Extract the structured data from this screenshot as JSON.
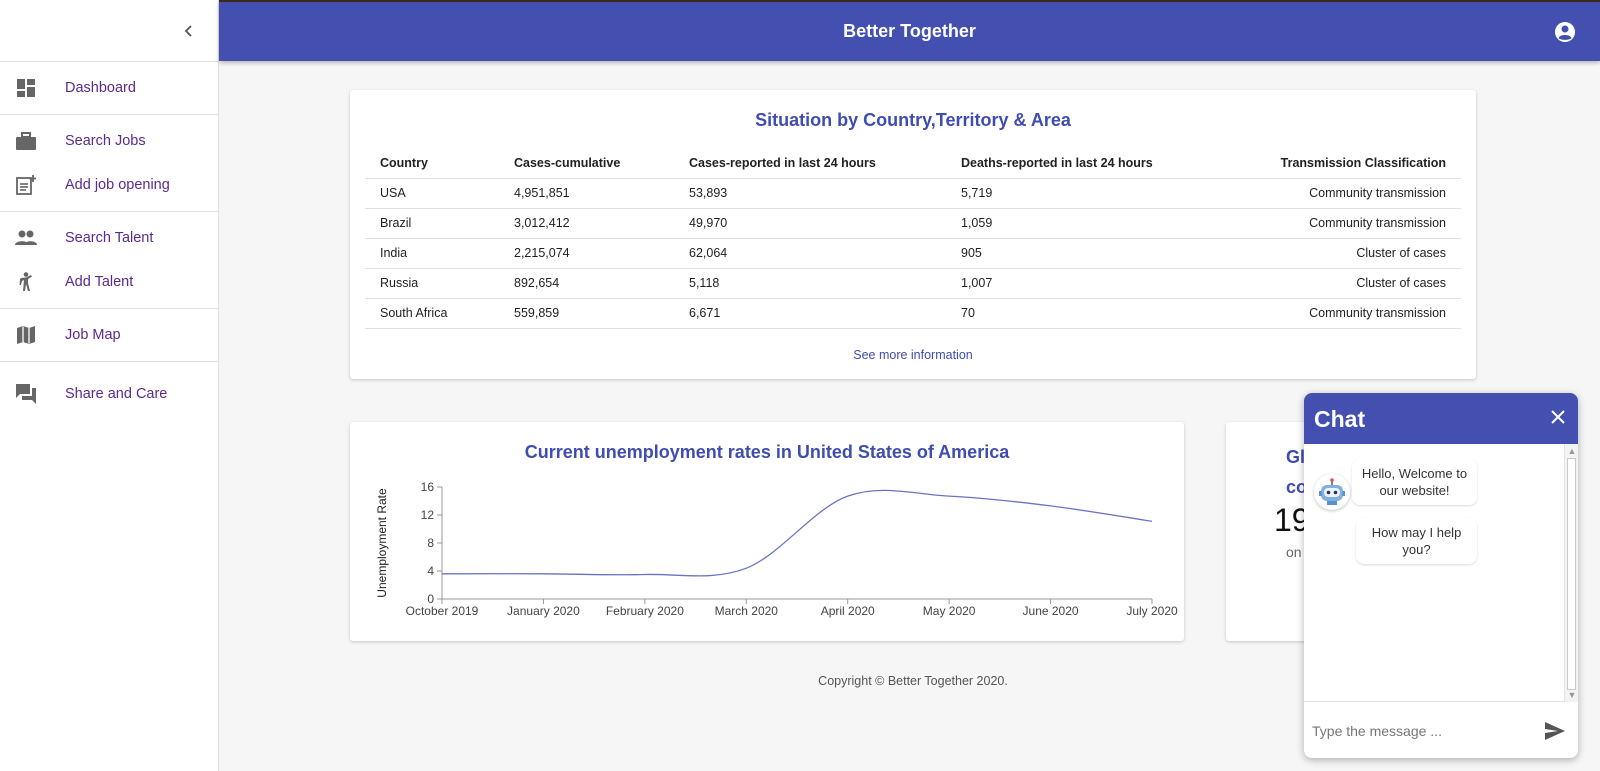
{
  "app": {
    "title": "Better Together"
  },
  "sidebar": {
    "items": [
      {
        "label": "Dashboard",
        "icon": "dashboard-icon"
      },
      {
        "label": "Search Jobs",
        "icon": "briefcase-icon"
      },
      {
        "label": "Add job opening",
        "icon": "post-add-icon"
      },
      {
        "label": "Search Talent",
        "icon": "people-icon"
      },
      {
        "label": "Add Talent",
        "icon": "person-add-icon"
      },
      {
        "label": "Job Map",
        "icon": "map-icon"
      },
      {
        "label": "Share and Care",
        "icon": "forum-icon"
      }
    ]
  },
  "situation": {
    "title": "Situation by Country,Territory & Area",
    "columns": [
      "Country",
      "Cases-cumulative",
      "Cases-reported in last 24 hours",
      "Deaths-reported in last 24 hours",
      "Transmission Classification"
    ],
    "rows": [
      [
        "USA",
        "4,951,851",
        "53,893",
        "5,719",
        "Community transmission"
      ],
      [
        "Brazil",
        "3,012,412",
        "49,970",
        "1,059",
        "Community transmission"
      ],
      [
        "India",
        "2,215,074",
        "62,064",
        "905",
        "Cluster of cases"
      ],
      [
        "Russia",
        "892,654",
        "5,118",
        "1,007",
        "Cluster of cases"
      ],
      [
        "South Africa",
        "559,859",
        "6,671",
        "70",
        "Community transmission"
      ]
    ],
    "see_more": "See more information"
  },
  "chart_data": {
    "type": "line",
    "title": "Current unemployment rates in United States of America",
    "xlabel": "",
    "ylabel": "Unemployment Rate",
    "categories": [
      "October 2019",
      "January 2020",
      "February 2020",
      "March 2020",
      "April 2020",
      "May 2020",
      "June 2020",
      "July 2020"
    ],
    "values": [
      3.6,
      3.6,
      3.5,
      4.4,
      14.7,
      14.7,
      13.3,
      11.1
    ],
    "ylim": [
      0,
      16
    ],
    "yticks": [
      "0",
      "4",
      "8",
      "12",
      "16"
    ],
    "grid": false,
    "color": "#6b72c4"
  },
  "global": {
    "title_line1": "Gl",
    "title_line2": "cor",
    "number": "19",
    "sub": "on"
  },
  "footer": {
    "text": "Copyright © Better Together 2020."
  },
  "chat": {
    "title": "Chat",
    "messages": [
      "Hello, Welcome to our website!",
      "How may I help you?"
    ],
    "input_placeholder": "Type the message ..."
  },
  "colors": {
    "primary": "#4350b0",
    "nav_text": "#5b2a90"
  }
}
